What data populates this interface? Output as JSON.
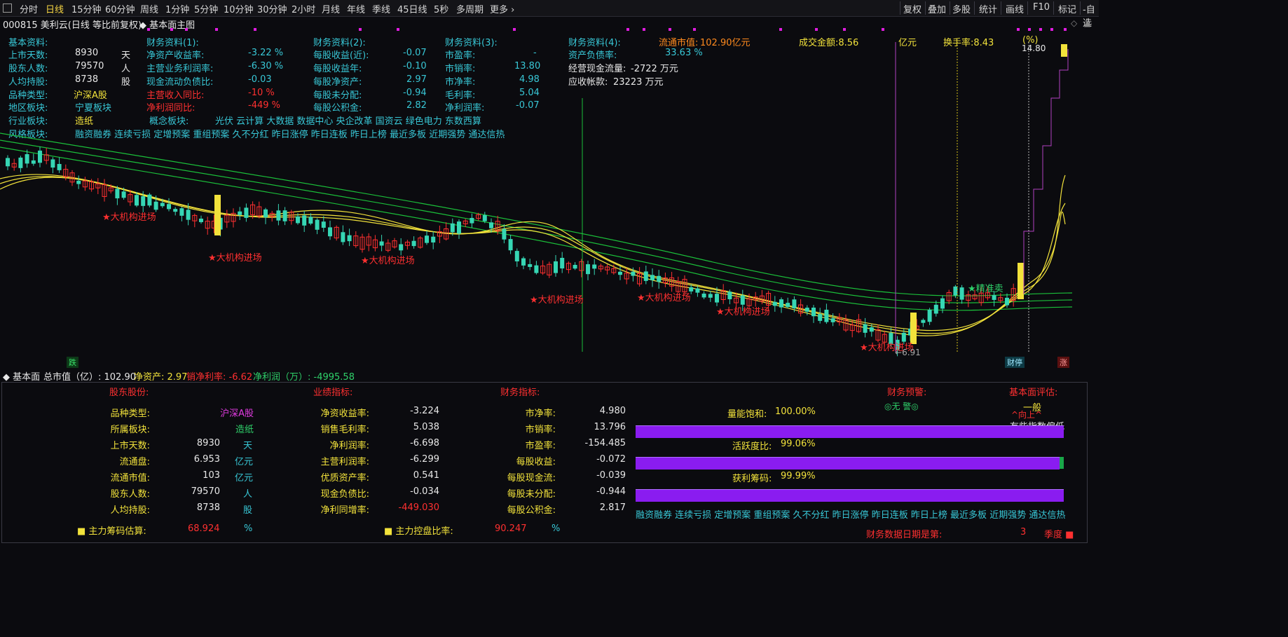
{
  "toolbar": {
    "left": [
      "分时",
      "日线",
      "15分钟",
      "60分钟",
      "周线",
      "1分钟",
      "5分钟",
      "10分钟",
      "30分钟",
      "2小时",
      "月线",
      "年线",
      "季线",
      "45日线",
      "5秒",
      "多周期",
      "更多"
    ],
    "right": [
      "复权",
      "叠加",
      "多股",
      "统计",
      "画线",
      "F10",
      "标记",
      "-自选"
    ]
  },
  "header": {
    "title": "000815 美利云(日线 等比前复权)",
    "main_label": "基本面主图"
  },
  "fund": {
    "col1": {
      "title": "基本资料:",
      "rows": [
        {
          "label": "上市天数:",
          "value": "8930",
          "unit": "天"
        },
        {
          "label": "股东人数:",
          "value": "79570",
          "unit": "人"
        },
        {
          "label": "人均持股:",
          "value": "8738",
          "unit": "股"
        }
      ],
      "variety_label": "品种类型:",
      "variety": "沪深A股",
      "region_label": "地区板块:",
      "region": "宁夏板块",
      "industry_label": "行业板块:",
      "industry": "造纸",
      "concept_label": "概念板块:",
      "concept": "光伏 云计算 大数据 数据中心 央企改革 国资云 绿色电力 东数西算",
      "style_label": "风格板块:",
      "style": "融资融券 连续亏损 定增预案 重组预案 久不分红 昨日涨停 昨日连板 昨日上榜 最近多板 近期强势 通达信热"
    },
    "col2": {
      "title": "财务资料(1):",
      "rows": [
        {
          "label": "净资产收益率:",
          "value": "-3.22 %"
        },
        {
          "label": "主营业务利润率:",
          "value": "-6.30 %"
        },
        {
          "label": "现金流动负债比:",
          "value": "-0.03"
        },
        {
          "label": "主营收入同比:",
          "value": "-10 %"
        },
        {
          "label": "净利润同比:",
          "value": "-449 %"
        }
      ]
    },
    "col3": {
      "title": "财务资料(2):",
      "rows": [
        {
          "label": "每股收益(近):",
          "value": "-0.07"
        },
        {
          "label": "每股收益年:",
          "value": "-0.10"
        },
        {
          "label": "每股净资产:",
          "value": "2.97"
        },
        {
          "label": "每股未分配:",
          "value": "-0.94"
        },
        {
          "label": "每股公积金:",
          "value": "2.82"
        }
      ]
    },
    "col4": {
      "title": "财务资料(3):",
      "rows": [
        {
          "label": "市盈率:",
          "value": "-"
        },
        {
          "label": "市销率:",
          "value": "13.80"
        },
        {
          "label": "市净率:",
          "value": "4.98"
        },
        {
          "label": "毛利率:",
          "value": "5.04"
        },
        {
          "label": "净利润率:",
          "value": "-0.07"
        }
      ]
    },
    "col5": {
      "title": "财务资料(4):",
      "debt_label": "资产负债率:",
      "debt": "33.63 %",
      "cashflow_label": "经营现金流量:",
      "cashflow": "-2722 万元",
      "receivable_label": "应收帐款:",
      "receivable": "23223 万元"
    },
    "float_mv_label": "流通市值:",
    "float_mv": "102.90亿元",
    "turnover_amt": "成交金额:8.56",
    "turnover_unit": "亿元",
    "turnover_rate": "换手率:8.43",
    "turnover_rate_unit": "(%)"
  },
  "chart": {
    "price_high": "14.80",
    "price_low": "6.91",
    "annotation": "★大机构进场",
    "precise_sell": "★精准卖",
    "die_label": "跌",
    "caiting_label": "财停",
    "zhang_label": "涨"
  },
  "bottom_header": {
    "label": "基本面",
    "total_mv": "总市值（亿）: 102.90",
    "net_asset": "净资产: 2.97",
    "net_margin": "销净利率: -6.62",
    "net_profit": "净利润（万）: -4995.58"
  },
  "panel": {
    "shareholder": {
      "title": "股东股份:",
      "rows": [
        {
          "label": "品种类型:",
          "value": "沪深A股",
          "unit": ""
        },
        {
          "label": "所属板块:",
          "value": "造纸",
          "unit": ""
        },
        {
          "label": "上市天数:",
          "value": "8930",
          "unit": "天"
        },
        {
          "label": "流通盘:",
          "value": "6.953",
          "unit": "亿元"
        },
        {
          "label": "流通市值:",
          "value": "103",
          "unit": "亿元"
        },
        {
          "label": "股东人数:",
          "value": "79570",
          "unit": "人"
        },
        {
          "label": "人均持股:",
          "value": "8738",
          "unit": "股"
        }
      ],
      "chip_label": "主力筹码估算:",
      "chip_value": "68.924",
      "chip_unit": "%"
    },
    "performance": {
      "title": "业绩指标:",
      "rows": [
        {
          "label": "净资收益率:",
          "value": "-3.224"
        },
        {
          "label": "销售毛利率:",
          "value": "5.038"
        },
        {
          "label": "净利润率:",
          "value": "-6.698"
        },
        {
          "label": "主营利润率:",
          "value": "-6.299"
        },
        {
          "label": "优质资产率:",
          "value": "0.541"
        },
        {
          "label": "现金负债比:",
          "value": "-0.034"
        },
        {
          "label": "净利同增率:",
          "value": "-449.030"
        }
      ],
      "control_label": "主力控盘比率:",
      "control_value": "90.247",
      "control_unit": "%"
    },
    "finance": {
      "title": "财务指标:",
      "rows": [
        {
          "label": "市净率:",
          "value": "4.980"
        },
        {
          "label": "市销率:",
          "value": "13.796"
        },
        {
          "label": "市盈率:",
          "value": "-154.485"
        },
        {
          "label": "每股收益:",
          "value": "-0.072"
        },
        {
          "label": "每股现金流:",
          "value": "-0.039"
        },
        {
          "label": "每股未分配:",
          "value": "-0.944"
        },
        {
          "label": "每股公积金:",
          "value": "2.817"
        }
      ]
    },
    "warning": {
      "title": "财务预警:",
      "status": "◎无 警◎",
      "value_est": "基本面评估:",
      "rating": "一般",
      "up": "^向上^",
      "note": "有些指数偏低"
    },
    "bars": [
      {
        "label": "量能饱和:",
        "value": "100.00%",
        "fill": 1.0
      },
      {
        "label": "活跃度比:",
        "value": "99.06%",
        "fill": 0.9906
      },
      {
        "label": "获利筹码:",
        "value": "99.99%",
        "fill": 0.9999
      }
    ],
    "tags": "融资融券 连续亏损 定增预案 重组预案 久不分红 昨日涨停 昨日连板 昨日上榜 最近多板 近期强势 通达信热",
    "report_label": "财务数据日期是第:",
    "report_value": "3",
    "report_unit": "季度"
  },
  "colors": {
    "up": "#ff3030",
    "down": "#36d6b4",
    "ma_yellow": "#f2e23b",
    "ma_green": "#1bbf3a",
    "bar_purple": "#8a1cf0"
  }
}
